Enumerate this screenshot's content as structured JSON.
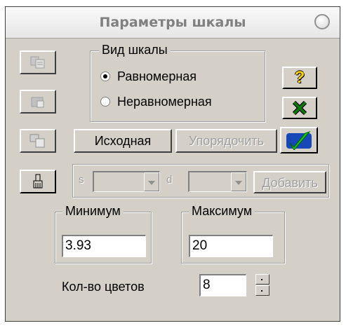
{
  "window": {
    "title": "Параметры шкалы"
  },
  "scale_type": {
    "legend": "Вид шкалы",
    "options": [
      {
        "label": "Равномерная",
        "selected": true
      },
      {
        "label": "Неравномерная",
        "selected": false
      }
    ]
  },
  "buttons": {
    "initial": "Исходная",
    "order": "Упорядочить",
    "add": "Добавить",
    "help": "?"
  },
  "add_row": {
    "s_label": "s",
    "d_label": "d",
    "s_value": "",
    "d_value": ""
  },
  "minimum": {
    "legend": "Минимум",
    "value": "3.93"
  },
  "maximum": {
    "legend": "Максимум",
    "value": "20"
  },
  "colors": {
    "label": "Кол-во цветов",
    "value": "8"
  },
  "icons": {
    "copy": "copy-icon",
    "paste": "paste-icon",
    "format": "format-icon",
    "paint": "paint-brush-icon",
    "help": "help-icon",
    "close": "close-x-icon",
    "apply": "apply-check-icon",
    "roll": "roll-button-icon"
  },
  "colors_theme": {
    "help": "#ffd200",
    "close": "#0a7a0a",
    "apply_bg": "#1848b8",
    "apply_check": "#10d010"
  }
}
